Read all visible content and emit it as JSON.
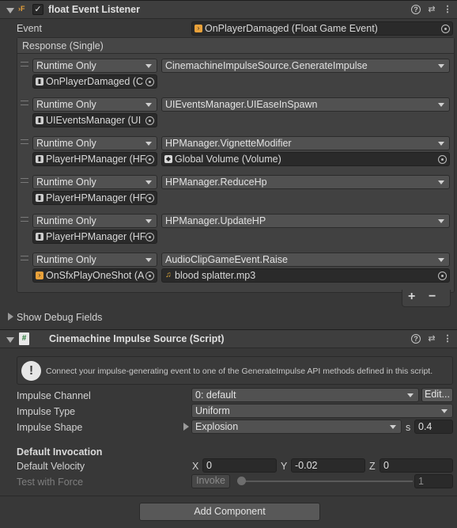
{
  "listener": {
    "title": "float Event Listener",
    "enabled_mark": "✓",
    "event_label": "Event",
    "event_value": "OnPlayerDamaged (Float Game Event)",
    "response_label": "Response (Single)",
    "rows": [
      {
        "mode": "Runtime Only",
        "function": "CinemachineImpulseSource.GenerateImpulse",
        "target": "OnPlayerDamaged (C",
        "arg": ""
      },
      {
        "mode": "Runtime Only",
        "function": "UIEventsManager.UIEaseInSpawn",
        "target": "UIEventsManager (UI",
        "arg": ""
      },
      {
        "mode": "Runtime Only",
        "function": "HPManager.VignetteModifier",
        "target": "PlayerHPManager (HF",
        "arg": "Global Volume (Volume)"
      },
      {
        "mode": "Runtime Only",
        "function": "HPManager.ReduceHp",
        "target": "PlayerHPManager (HF",
        "arg": ""
      },
      {
        "mode": "Runtime Only",
        "function": "HPManager.UpdateHP",
        "target": "PlayerHPManager (HF",
        "arg": ""
      },
      {
        "mode": "Runtime Only",
        "function": "AudioClipGameEvent.Raise",
        "target": "OnSfxPlayOneShot (A",
        "arg": "blood splatter.mp3"
      }
    ],
    "add_label": "+",
    "remove_label": "−",
    "debug_label": "Show Debug Fields"
  },
  "impulse": {
    "title": "Cinemachine Impulse Source (Script)",
    "info": "Connect your impulse-generating event to one of the GenerateImpulse API methods defined in this script.",
    "channel_label": "Impulse Channel",
    "channel_value": "0: default",
    "edit_label": "Edit...",
    "type_label": "Impulse Type",
    "type_value": "Uniform",
    "shape_label": "Impulse Shape",
    "shape_value": "Explosion",
    "s_label": "s",
    "s_value": "0.4",
    "default_header": "Default Invocation",
    "velocity_label": "Default Velocity",
    "x_label": "X",
    "x_value": "0",
    "y_label": "Y",
    "y_value": "-0.02",
    "z_label": "Z",
    "z_value": "0",
    "test_label": "Test with Force",
    "invoke_label": "Invoke",
    "force_value": "1",
    "force_fraction": 0
  },
  "footer": {
    "add_component": "Add Component"
  },
  "colors": {
    "bg": "#383838",
    "header": "#3e3e3e",
    "field": "#2a2a2a",
    "dropdown": "#515151"
  }
}
